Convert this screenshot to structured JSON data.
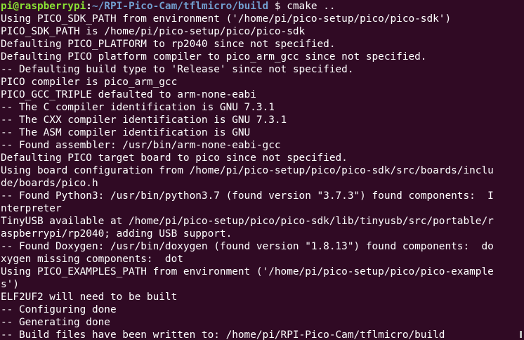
{
  "prompt": {
    "user_host": "pi@raspberrypi",
    "separator": ":",
    "path": "~/RPI-Pico-Cam/tflmicro/build",
    "dollar": " $ ",
    "command": "cmake .."
  },
  "output_lines": [
    "Using PICO_SDK_PATH from environment ('/home/pi/pico-setup/pico/pico-sdk')",
    "PICO_SDK_PATH is /home/pi/pico-setup/pico/pico-sdk",
    "Defaulting PICO_PLATFORM to rp2040 since not specified.",
    "Defaulting PICO platform compiler to pico_arm_gcc since not specified.",
    "-- Defaulting build type to 'Release' since not specified.",
    "PICO compiler is pico_arm_gcc",
    "PICO_GCC_TRIPLE defaulted to arm-none-eabi",
    "-- The C compiler identification is GNU 7.3.1",
    "-- The CXX compiler identification is GNU 7.3.1",
    "-- The ASM compiler identification is GNU",
    "-- Found assembler: /usr/bin/arm-none-eabi-gcc",
    "Defaulting PICO target board to pico since not specified.",
    "Using board configuration from /home/pi/pico-setup/pico/pico-sdk/src/boards/inclu",
    "de/boards/pico.h",
    "-- Found Python3: /usr/bin/python3.7 (found version \"3.7.3\") found components:  I",
    "nterpreter",
    "TinyUSB available at /home/pi/pico-setup/pico/pico-sdk/lib/tinyusb/src/portable/r",
    "aspberrypi/rp2040; adding USB support.",
    "-- Found Doxygen: /usr/bin/doxygen (found version \"1.8.13\") found components:  do",
    "xygen missing components:  dot",
    "Using PICO_EXAMPLES_PATH from environment ('/home/pi/pico-setup/pico/pico-example",
    "s')",
    "ELF2UF2 will need to be built",
    "-- Configuring done",
    "-- Generating done",
    "-- Build files have been written to: /home/pi/RPI-Pico-Cam/tflmicro/build"
  ],
  "colors": {
    "background": "#300a24",
    "text": "#ffffff",
    "user_host": "#8ae234",
    "path": "#729fcf"
  }
}
